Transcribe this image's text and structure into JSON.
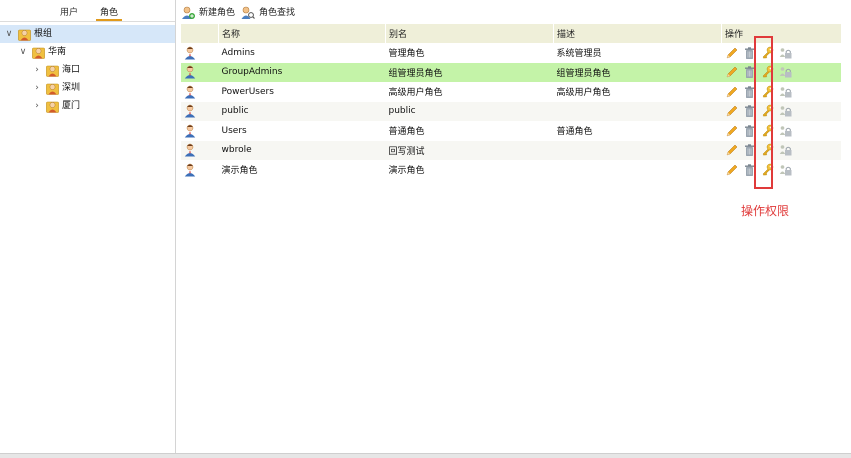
{
  "left": {
    "tabs": [
      {
        "label": "用户",
        "active": false
      },
      {
        "label": "角色",
        "active": true
      }
    ],
    "tree": [
      {
        "label": "根组",
        "level": 0,
        "expanded": true,
        "selected": true,
        "arrow": "∨"
      },
      {
        "label": "华南",
        "level": 1,
        "expanded": true,
        "selected": false,
        "arrow": "∨"
      },
      {
        "label": "海口",
        "level": 2,
        "expanded": false,
        "selected": false,
        "arrow": "›"
      },
      {
        "label": "深圳",
        "level": 2,
        "expanded": false,
        "selected": false,
        "arrow": "›"
      },
      {
        "label": "厦门",
        "level": 2,
        "expanded": false,
        "selected": false,
        "arrow": "›"
      }
    ]
  },
  "toolbar": {
    "new_role": "新建角色",
    "find_role": "角色查找"
  },
  "table": {
    "headers": [
      "名称",
      "别名",
      "描述",
      "操作"
    ],
    "rows": [
      {
        "name": "Admins",
        "alias": "管理角色",
        "desc": "系统管理员",
        "highlight": false
      },
      {
        "name": "GroupAdmins",
        "alias": "组管理员角色",
        "desc": "组管理员角色",
        "highlight": true
      },
      {
        "name": "PowerUsers",
        "alias": "高级用户角色",
        "desc": "高级用户角色",
        "highlight": false
      },
      {
        "name": "public",
        "alias": "public",
        "desc": "",
        "highlight": false
      },
      {
        "name": "Users",
        "alias": "普通角色",
        "desc": "普通角色",
        "highlight": false
      },
      {
        "name": "wbrole",
        "alias": "回写测试",
        "desc": "",
        "highlight": false
      },
      {
        "name": "演示角色",
        "alias": "演示角色",
        "desc": "",
        "highlight": false
      }
    ],
    "op_icons": [
      "pencil-icon",
      "trash-icon",
      "key-icon",
      "lock-people-icon"
    ]
  },
  "annotation": {
    "label": "操作权限",
    "color": "#e03a3a"
  },
  "colors": {
    "highlight_row": "#c4f3a8",
    "header_bg": "#efefd9",
    "tree_selected": "#d6e7f9",
    "tab_underline": "#e09a1c"
  }
}
